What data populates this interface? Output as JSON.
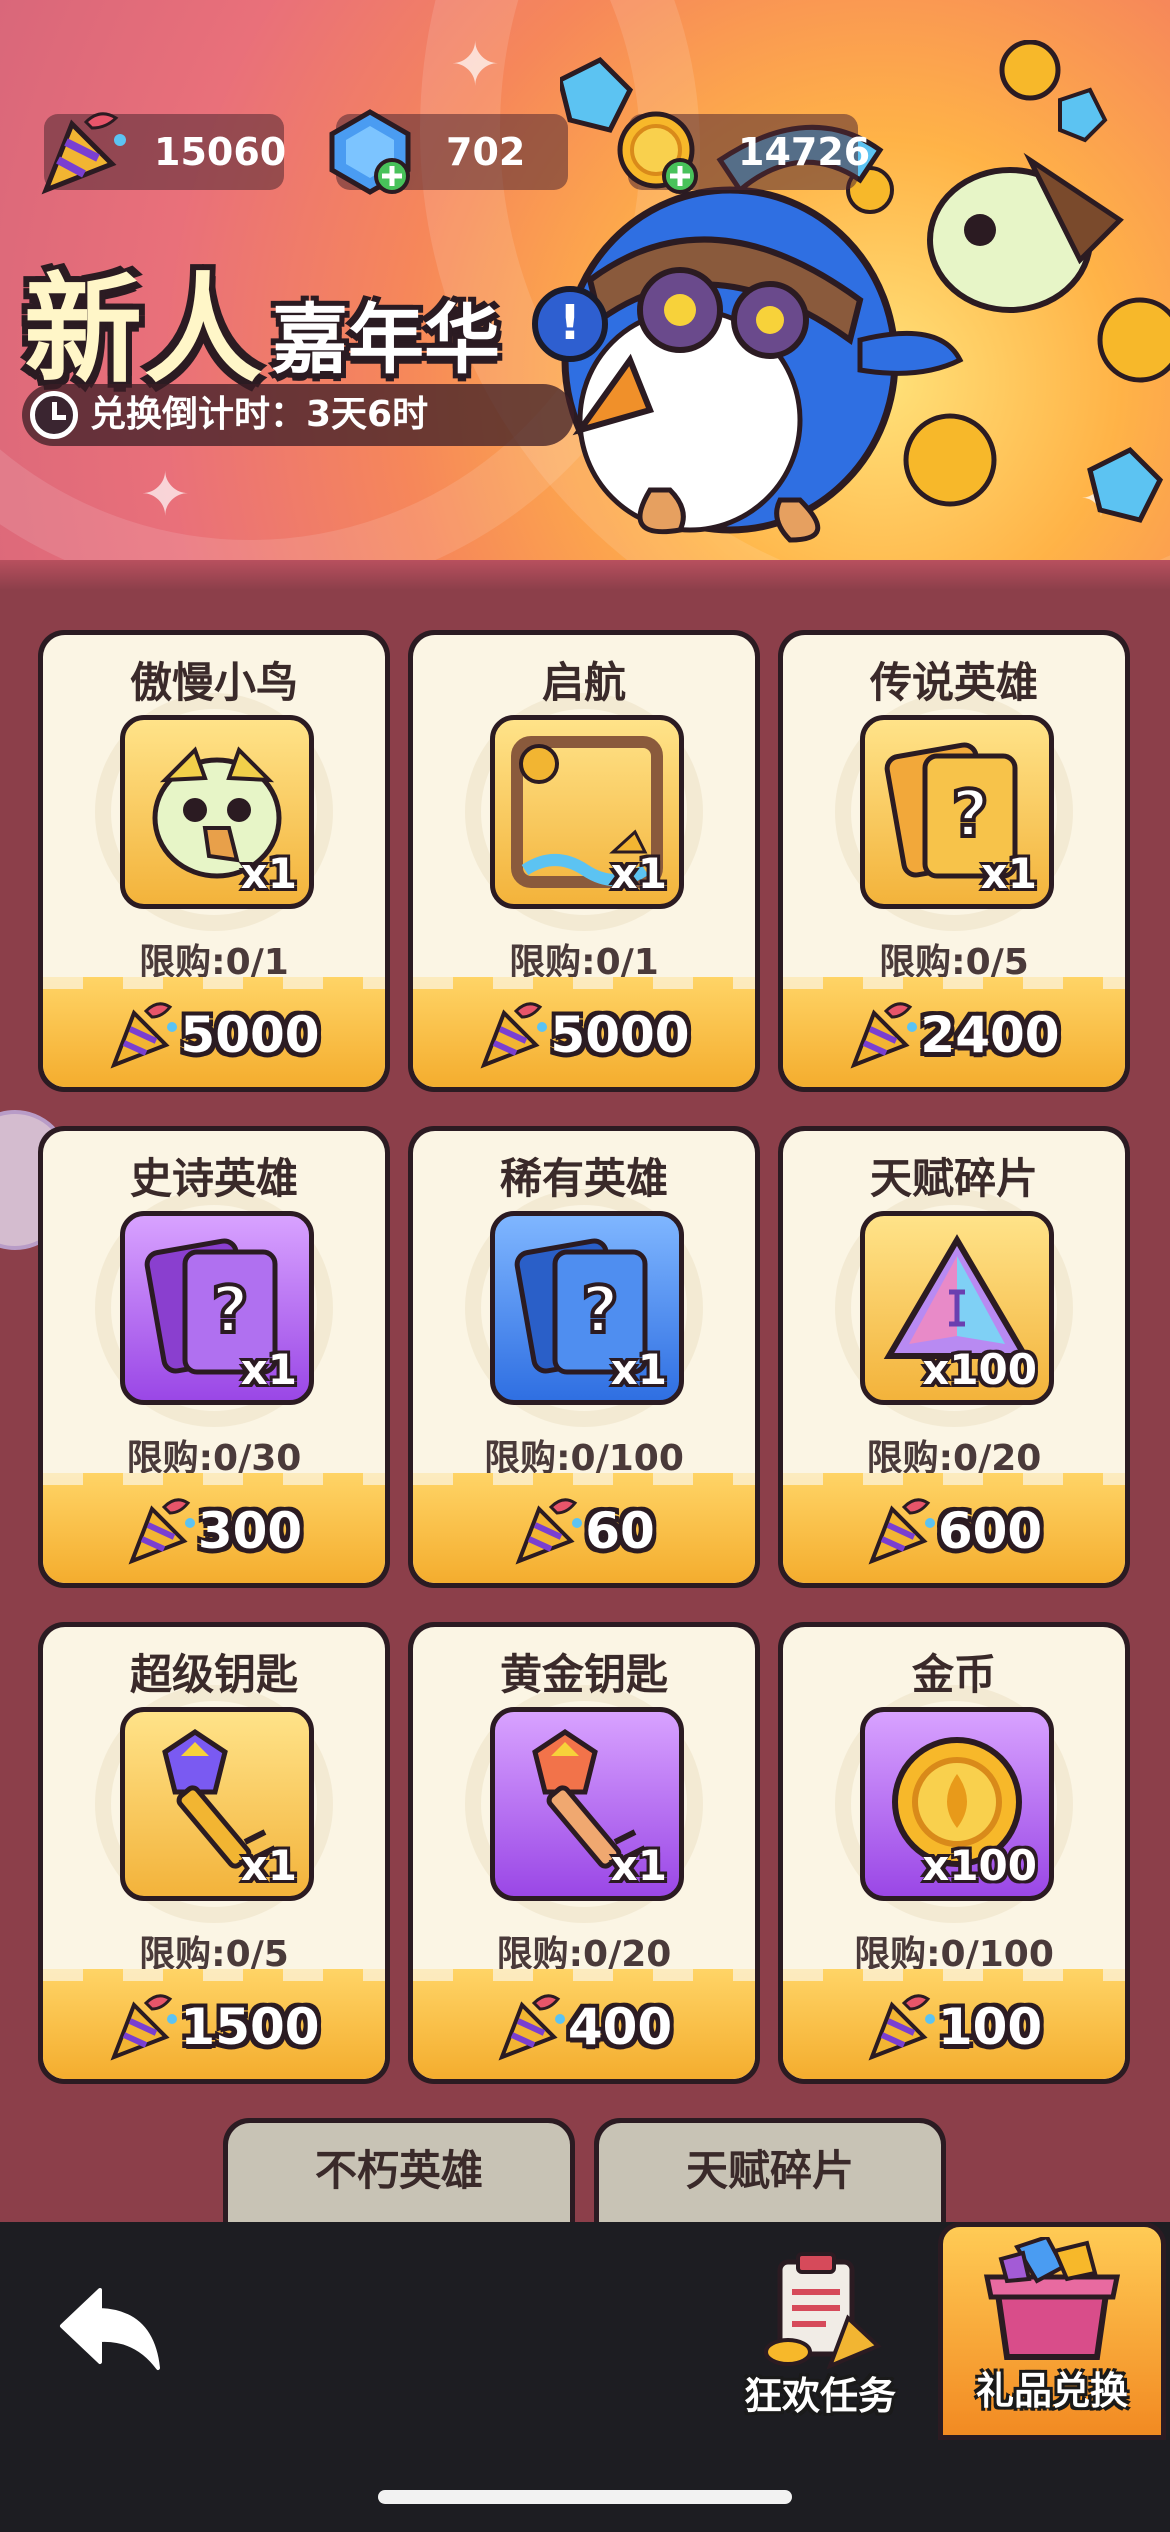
{
  "header": {
    "resources": [
      {
        "icon": "party-popper-icon",
        "value": "15060"
      },
      {
        "icon": "blue-gem-icon",
        "value": "702"
      },
      {
        "icon": "gold-coin-icon",
        "value": "14726"
      }
    ],
    "title_main": "新人",
    "title_sub": "嘉年华",
    "countdown": "兑换倒计时：3天6时"
  },
  "items": [
    {
      "name": "傲慢小鸟",
      "qty": "x1",
      "limit": "限购:0/1",
      "price": "5000",
      "box": "gold",
      "icon": "bird-avatar-icon"
    },
    {
      "name": "启航",
      "qty": "x1",
      "limit": "限购:0/1",
      "price": "5000",
      "box": "gold",
      "icon": "ship-frame-icon"
    },
    {
      "name": "传说英雄",
      "qty": "x1",
      "limit": "限购:0/5",
      "price": "2400",
      "box": "gold",
      "icon": "legend-card-icon"
    },
    {
      "name": "史诗英雄",
      "qty": "x1",
      "limit": "限购:0/30",
      "price": "300",
      "box": "purple",
      "icon": "epic-card-icon"
    },
    {
      "name": "稀有英雄",
      "qty": "x1",
      "limit": "限购:0/100",
      "price": "60",
      "box": "blue",
      "icon": "rare-card-icon"
    },
    {
      "name": "天赋碎片",
      "qty": "x100",
      "limit": "限购:0/20",
      "price": "600",
      "box": "gold",
      "icon": "talent-shard-icon"
    },
    {
      "name": "超级钥匙",
      "qty": "x1",
      "limit": "限购:0/5",
      "price": "1500",
      "box": "gold",
      "icon": "super-key-icon"
    },
    {
      "name": "黄金钥匙",
      "qty": "x1",
      "limit": "限购:0/20",
      "price": "400",
      "box": "purple",
      "icon": "gold-key-icon"
    },
    {
      "name": "金币",
      "qty": "x100",
      "limit": "限购:0/100",
      "price": "100",
      "box": "purple",
      "icon": "coin-icon"
    }
  ],
  "partial_items": [
    {
      "name": "不朽英雄"
    },
    {
      "name": "天赋碎片"
    }
  ],
  "nav": {
    "tasks_label": "狂欢任务",
    "exchange_label": "礼品兑换"
  },
  "colors": {
    "background": "#8c3f4a",
    "card_border": "#2b1b22",
    "gold_box": "#f3b33b",
    "purple_box": "#9a47e6",
    "blue_box": "#2f6fe2",
    "active_tab": "#f28a22"
  }
}
